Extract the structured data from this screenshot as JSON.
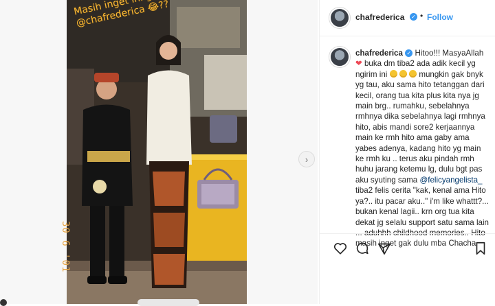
{
  "post": {
    "overlay_text": [
      "Masih inget ini ga mba",
      "@chafrederica 😂??"
    ],
    "date_stamp": "30 6 '01",
    "next_icon": "chevron-right-icon"
  },
  "header": {
    "username": "chafrederica",
    "dot": "•",
    "follow_label": "Follow"
  },
  "comment": {
    "username": "chafrederica",
    "part1": " Hitoo!!! MasyaAllah ",
    "part2": " buka dm tiba2 ada adik kecil yg ngirim ini ",
    "part3": " mungkin gak bnyk yg tau, aku sama hito tetanggan dari kecil, orang tua kita plus kita nya jg main brg.. rumahku, sebelahnya rmhnya dika sebelahnya lagi rmhnya hito, abis mandi sore2 kerjaannya main ke rmh hito ama gaby ama yabes adenya, kadang hito yg main ke rmh ku .. terus aku pindah rmh huhu jarang ketemu lg, dulu bgt pas aku syuting sama ",
    "mention": "@felicyangelista_",
    "part4": " tiba2 felis cerita \"kak, kenal ama Hito ya?.. itu pacar aku..\" i'm like whattt?... bukan kenal lagii.. krn org tua kita dekat jg selalu support satu sama lain ... aduhhh childhood memories.. Hito masih inget gak dulu mba Chacha"
  },
  "actions": {
    "like_icon": "heart-icon",
    "comment_icon": "comment-icon",
    "share_icon": "share-icon",
    "save_icon": "bookmark-icon"
  },
  "colors": {
    "accent": "#3897f0",
    "overlay_text": "#f5b637",
    "heart": "#ed4956"
  }
}
